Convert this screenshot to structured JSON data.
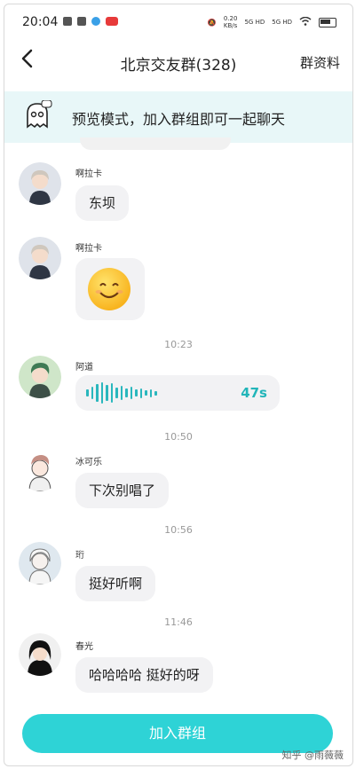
{
  "status_bar": {
    "time": "20:04",
    "net_speed": "0.20\nKB/s",
    "sig1": "5G HD",
    "sig2": "5G HD"
  },
  "nav": {
    "back_icon": "chevron-left-icon",
    "title": "北京交友群(328)",
    "group_info": "群资料"
  },
  "banner": {
    "icon": "ghost-icon",
    "text": "预览模式，加入群组即可一起聊天"
  },
  "messages": [
    {
      "sender": "啊拉卡",
      "type": "text",
      "text": "东坝"
    },
    {
      "sender": "啊拉卡",
      "type": "emoji",
      "emoji": "smile-emoji"
    },
    {
      "time": "10:23"
    },
    {
      "sender": "阿道",
      "type": "voice",
      "duration": "47s"
    },
    {
      "time": "10:50"
    },
    {
      "sender": "冰可乐",
      "type": "text",
      "text": "下次别唱了"
    },
    {
      "time": "10:56"
    },
    {
      "sender": "珩",
      "type": "text",
      "text": "挺好听啊"
    },
    {
      "time": "11:46"
    },
    {
      "sender": "春光",
      "type": "text",
      "text": "哈哈哈哈 挺好的呀"
    }
  ],
  "bottom": {
    "join_label": "加入群组",
    "watermark": "知乎 @雨薇薇"
  },
  "colors": {
    "accent": "#2ed3d6",
    "banner_bg": "#e8f7f8",
    "voice": "#2ab7bd"
  }
}
